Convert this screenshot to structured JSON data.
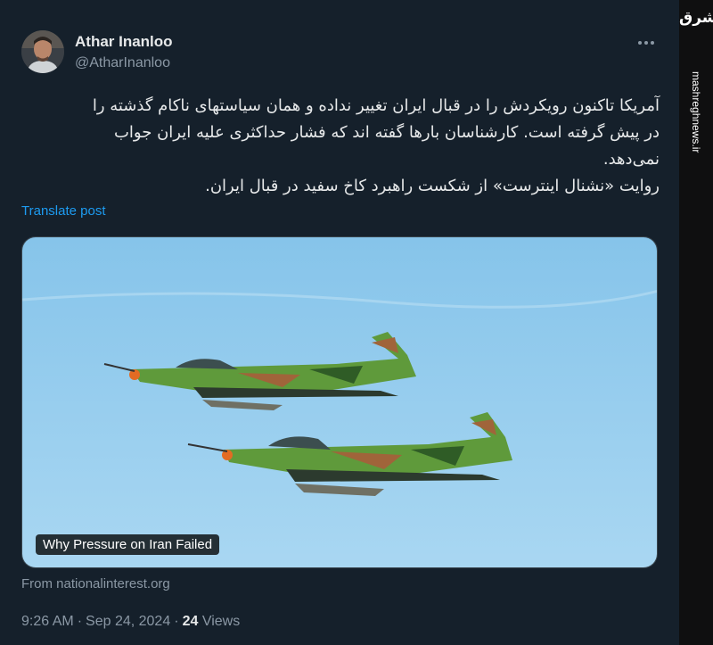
{
  "author": {
    "name": "Athar Inanloo",
    "handle": "@AtharInanloo"
  },
  "tweet": {
    "lines": [
      "آمریکا تاکنون رویکردش را در قبال ایران تغییر نداده و همان سیاستهای ناکام گذشته را",
      "در پیش گرفته است. کارشناسان بارها گفته اند که فشار حداکثری علیه ایران جواب",
      "نمی‌دهد.",
      "روایت «نشنال اینترست» از  شکست راهبرد کاخ سفید در قبال ایران."
    ],
    "translate_label": "Translate post"
  },
  "card": {
    "title": "Why Pressure on Iran Failed",
    "source": "From nationalinterest.org"
  },
  "meta": {
    "time": "9:26 AM",
    "date": "Sep 24, 2024",
    "views_count": "24",
    "views_label": "Views",
    "separator": "·"
  },
  "watermark": {
    "logo": "مشرق",
    "url": "mashreghnews.ir"
  },
  "colors": {
    "background": "#15202b",
    "text": "#e7e9ea",
    "secondary": "#8b98a5",
    "link": "#1d9bf0",
    "sky": "#8cc8ea"
  },
  "icons": [
    "more-options-icon"
  ]
}
